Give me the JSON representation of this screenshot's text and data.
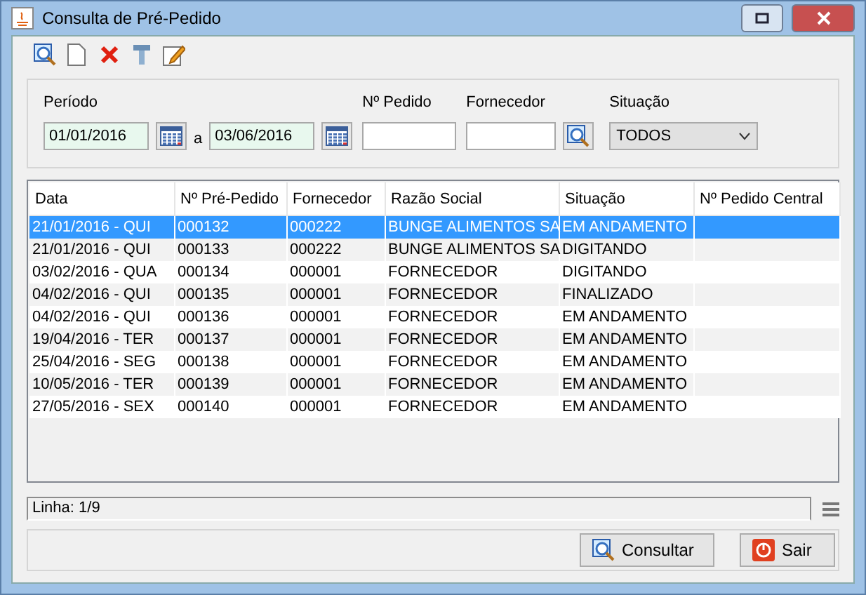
{
  "window": {
    "title": "Consulta de Pré-Pedido"
  },
  "filters": {
    "periodo_label": "Período",
    "date_from": "01/01/2016",
    "between": "a",
    "date_to": "03/06/2016",
    "pedido_label": "Nº Pedido",
    "fornecedor_label": "Fornecedor",
    "situacao_label": "Situação",
    "situacao_value": "TODOS"
  },
  "table": {
    "columns": [
      "Data",
      "Nº Pré-Pedido",
      "Fornecedor",
      "Razão Social",
      "Situação",
      "Nº Pedido Central"
    ],
    "rows": [
      {
        "cells": [
          "21/01/2016 - QUI",
          "000132",
          "000222",
          "BUNGE ALIMENTOS SA",
          "EM ANDAMENTO",
          ""
        ],
        "selected": true
      },
      {
        "cells": [
          "21/01/2016 - QUI",
          "000133",
          "000222",
          "BUNGE ALIMENTOS SA",
          "DIGITANDO",
          ""
        ],
        "selected": false
      },
      {
        "cells": [
          "03/02/2016 - QUA",
          "000134",
          "000001",
          "FORNECEDOR",
          "DIGITANDO",
          ""
        ],
        "selected": false
      },
      {
        "cells": [
          "04/02/2016 - QUI",
          "000135",
          "000001",
          "FORNECEDOR",
          "FINALIZADO",
          ""
        ],
        "selected": false
      },
      {
        "cells": [
          "04/02/2016 - QUI",
          "000136",
          "000001",
          "FORNECEDOR",
          "EM ANDAMENTO",
          ""
        ],
        "selected": false
      },
      {
        "cells": [
          "19/04/2016 - TER",
          "000137",
          "000001",
          "FORNECEDOR",
          "EM ANDAMENTO",
          ""
        ],
        "selected": false
      },
      {
        "cells": [
          "25/04/2016 - SEG",
          "000138",
          "000001",
          "FORNECEDOR",
          "EM ANDAMENTO",
          ""
        ],
        "selected": false
      },
      {
        "cells": [
          "10/05/2016 - TER",
          "000139",
          "000001",
          "FORNECEDOR",
          "EM ANDAMENTO",
          ""
        ],
        "selected": false
      },
      {
        "cells": [
          "27/05/2016 - SEX",
          "000140",
          "000001",
          "FORNECEDOR",
          "EM ANDAMENTO",
          ""
        ],
        "selected": false
      }
    ]
  },
  "status_bar": {
    "text": "Linha: 1/9"
  },
  "buttons": [
    {
      "kind": "search",
      "label": "Consultar"
    },
    {
      "kind": "exit",
      "label": "Sair"
    }
  ]
}
